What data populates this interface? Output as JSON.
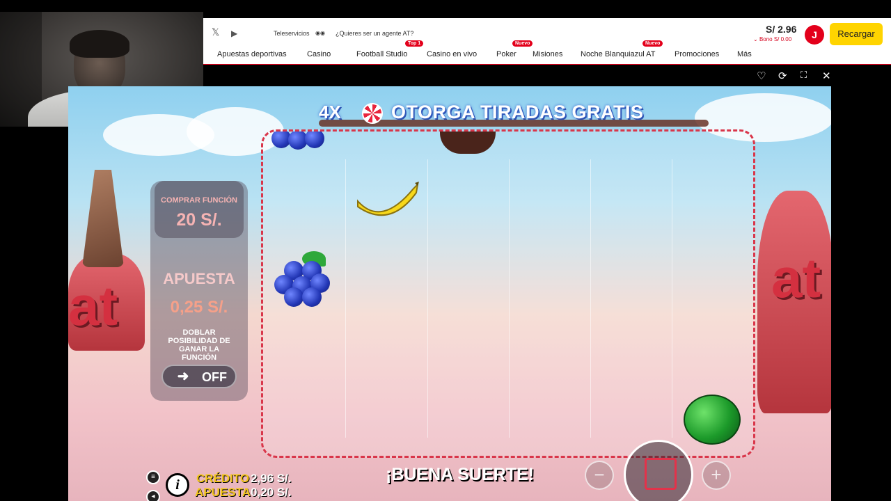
{
  "site": {
    "social_icons": [
      "x-icon",
      "youtube-icon"
    ],
    "teleservicios": "Teleservicios",
    "agent_link": "¿Quieres ser un agente AT?",
    "balance": "S/ 2.96",
    "bono": "Bono S/ 0.00",
    "avatar_letter": "J",
    "recharge_label": "Recargar",
    "brand_color": "#e3001b",
    "recharge_color": "#ffd400",
    "nav": [
      {
        "label": "Apuestas deportivas"
      },
      {
        "label": "Casino"
      },
      {
        "label": "Football Studio",
        "badge": "Top 1"
      },
      {
        "label": "Casino en vivo"
      },
      {
        "label": "Poker",
        "badge": "Nuevo"
      },
      {
        "label": "Misiones"
      },
      {
        "label": "Noche Blanquiazul AT",
        "badge": "Nuevo"
      },
      {
        "label": "Promociones"
      },
      {
        "label": "Más"
      }
    ],
    "game_tools": [
      "heart-icon",
      "refresh-icon",
      "fullscreen-icon",
      "close-icon"
    ]
  },
  "game": {
    "banner_multiplier": "4X",
    "banner_title": "OTORGA TIRADAS GRATIS",
    "buy_label": "COMPRAR FUNCIÓN",
    "buy_price": "20 S/.",
    "bet_label": "APUESTA",
    "bet_value": "0,25 S/.",
    "double_label": "DOBLAR POSIBILIDAD DE GANAR LA FUNCIÓN",
    "toggle_state": "OFF",
    "credit_label": "CRÉDITO",
    "credit_value": "2,96 S/.",
    "stake_label": "APUESTA",
    "stake_value": "0,20 S/.",
    "luck_message": "¡BUENA SUERTE!",
    "minus_label": "−",
    "plus_label": "+",
    "info_label": "i",
    "symbols_visible": [
      "grape",
      "chocolate",
      "banana",
      "grape",
      "watermelon"
    ]
  }
}
